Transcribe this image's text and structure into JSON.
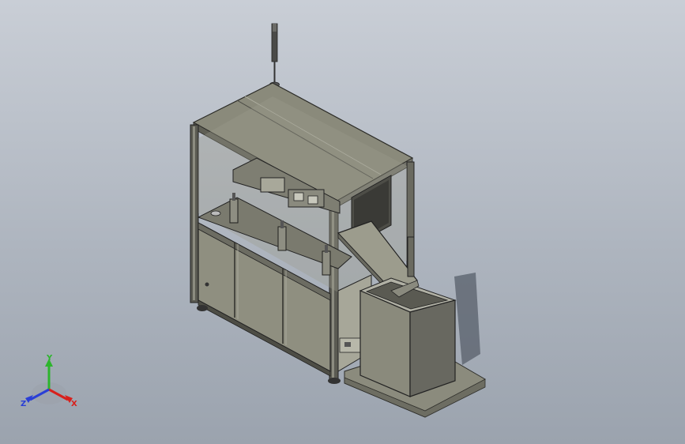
{
  "triad": {
    "x_label": "X",
    "y_label": "Y",
    "z_label": "Z",
    "colors": {
      "x": "#d8201c",
      "y": "#2db52d",
      "z": "#2a3fd6"
    }
  },
  "model": {
    "icons": [
      "signal-tower-icon",
      "machine-frame",
      "chute",
      "collection-bin"
    ]
  }
}
